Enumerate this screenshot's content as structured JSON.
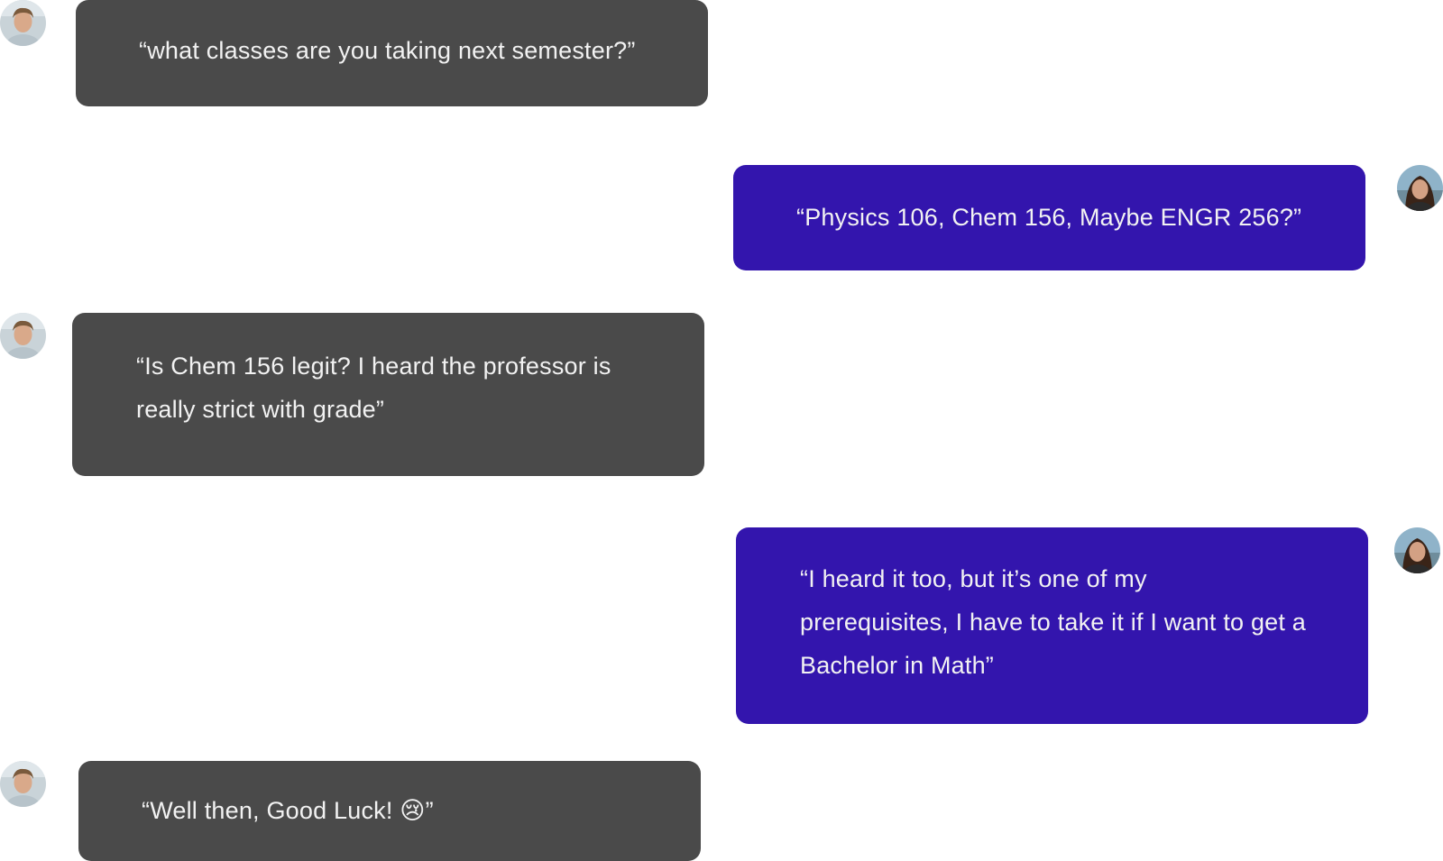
{
  "conversation": {
    "messages": [
      {
        "sender": "other",
        "text": "“what classes are you taking next semester?”"
      },
      {
        "sender": "self",
        "text": "“Physics 106, Chem 156, Maybe ENGR 256?”"
      },
      {
        "sender": "other",
        "text": "“Is Chem 156 legit? I heard the professor is\nreally strict with grade”"
      },
      {
        "sender": "self",
        "text": "“I heard it too, but it’s one of my\nprerequisites, I have to take it if I want to get a\nBachelor in Math”"
      },
      {
        "sender": "other",
        "text": "“Well then, Good Luck! 😢”"
      }
    ]
  },
  "avatars": {
    "other": {
      "icon": "male-user-avatar-icon"
    },
    "self": {
      "icon": "female-user-avatar-icon"
    }
  },
  "colors": {
    "other_bubble": "#4a4a4a",
    "self_bubble": "#3315ad",
    "bubble_text": "#f2f2f2",
    "background": "#ffffff"
  }
}
